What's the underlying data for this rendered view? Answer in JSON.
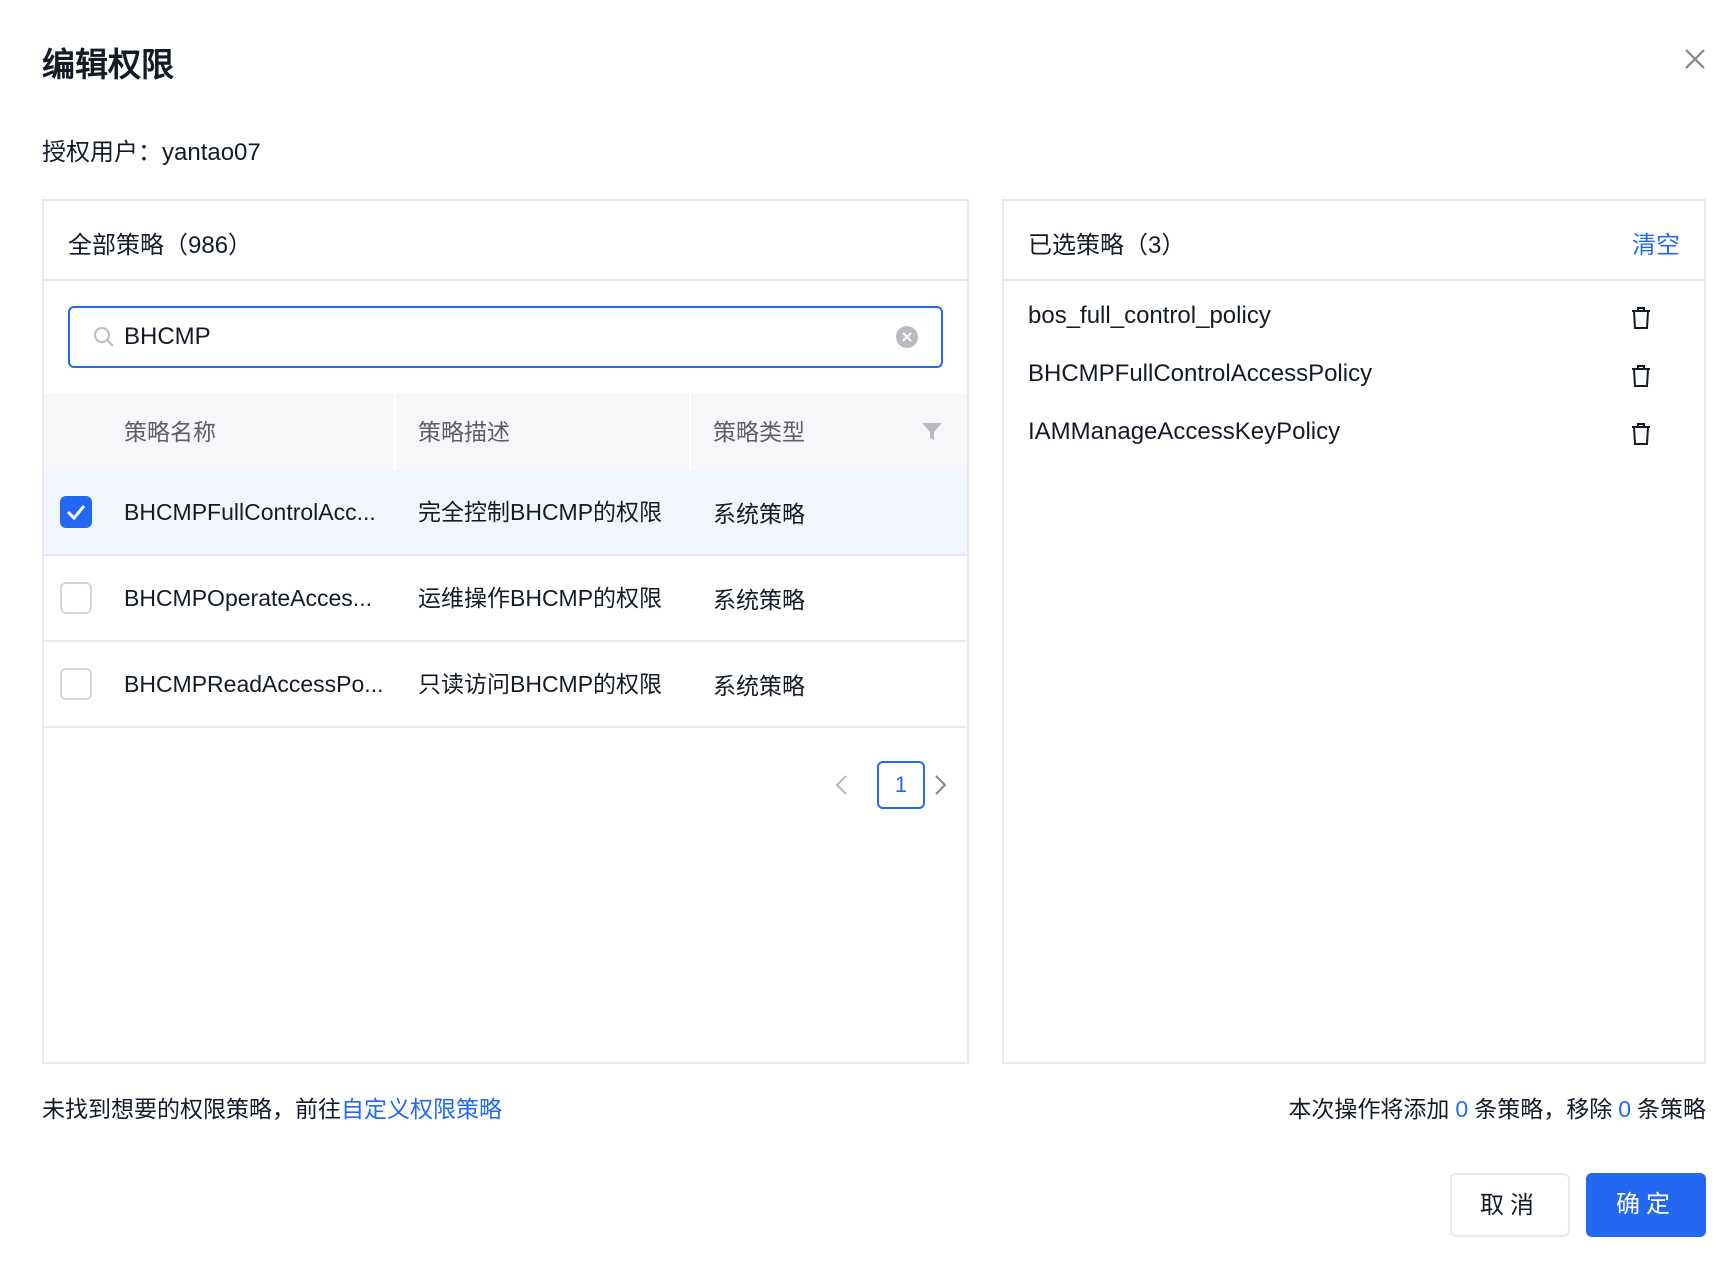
{
  "dialog": {
    "title": "编辑权限",
    "user_label": "授权用户：",
    "user_name": "yantao07"
  },
  "left_panel": {
    "title": "全部策略（986）",
    "search": {
      "value": "BHCMP",
      "placeholder": ""
    },
    "columns": [
      "策略名称",
      "策略描述",
      "策略类型"
    ],
    "rows": [
      {
        "checked": true,
        "name": "BHCMPFullControlAcc...",
        "desc": "完全控制BHCMP的权限",
        "type": "系统策略"
      },
      {
        "checked": false,
        "name": "BHCMPOperateAcces...",
        "desc": "运维操作BHCMP的权限",
        "type": "系统策略"
      },
      {
        "checked": false,
        "name": "BHCMPReadAccessPo...",
        "desc": "只读访问BHCMP的权限",
        "type": "系统策略"
      }
    ],
    "pagination": {
      "current_page": "1"
    }
  },
  "right_panel": {
    "title": "已选策略（3）",
    "clear_label": "清空",
    "items": [
      "bos_full_control_policy",
      "BHCMPFullControlAccessPolicy",
      "IAMManageAccessKeyPolicy"
    ]
  },
  "footer": {
    "hint_text": "未找到想要的权限策略，前往",
    "hint_link": "自定义权限策略",
    "summary_prefix": "本次操作将添加",
    "add_count": "0",
    "summary_mid": "条策略，移除",
    "remove_count": "0",
    "summary_suffix": "条策略"
  },
  "buttons": {
    "cancel": "取消",
    "confirm": "确定"
  },
  "colors": {
    "accent": "#2468f2",
    "border": "#e8e9eb",
    "selected_row": "#f1f6fe"
  }
}
